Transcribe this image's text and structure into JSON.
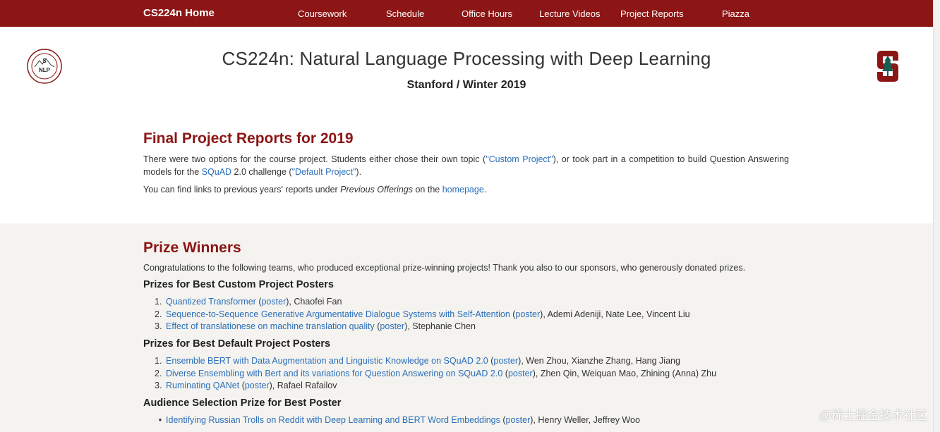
{
  "nav": {
    "brand": "CS224n Home",
    "links": [
      "Coursework",
      "Schedule",
      "Office Hours",
      "Lecture Videos",
      "Project Reports",
      "Piazza"
    ]
  },
  "header": {
    "title": "CS224n: Natural Language Processing with Deep Learning",
    "subtitle": "Stanford / Winter 2019",
    "seal_top_text": "S",
    "seal_bottom_text": "NLP"
  },
  "reports": {
    "title": "Final Project Reports for 2019",
    "p1_a": "There were two options for the course project. Students either chose their own topic (",
    "p1_link1": "\"Custom Project\"",
    "p1_b": "), or took part in a competition to build Question Answering models for the ",
    "p1_link2": "SQuAD",
    "p1_c": " 2.0 challenge (",
    "p1_link3": "\"Default Project\"",
    "p1_d": ").",
    "p2_a": "You can find links to previous years' reports under ",
    "p2_em": "Previous Offerings",
    "p2_b": " on the ",
    "p2_link": "homepage",
    "p2_c": "."
  },
  "prizes": {
    "title": "Prize Winners",
    "intro": "Congratulations to the following teams, who produced exceptional prize-winning projects! Thank you also to our sponsors, who generously donated prizes.",
    "custom": {
      "heading": "Prizes for Best Custom Project Posters",
      "items": [
        {
          "n": "1.",
          "title": "Quantized Transformer",
          "poster": "poster",
          "authors": "), Chaofei Fan"
        },
        {
          "n": "2.",
          "title": "Sequence-to-Sequence Generative Argumentative Dialogue Systems with Self-Attention",
          "poster": "poster",
          "authors": "), Ademi Adeniji, Nate Lee, Vincent Liu"
        },
        {
          "n": "3.",
          "title": "Effect of translationese on machine translation quality",
          "poster": "poster",
          "authors": "), Stephanie Chen"
        }
      ]
    },
    "default": {
      "heading": "Prizes for Best Default Project Posters",
      "items": [
        {
          "n": "1.",
          "title": "Ensemble BERT with Data Augmentation and Linguistic Knowledge on SQuAD 2.0",
          "poster": "poster",
          "authors": "), Wen Zhou, Xianzhe Zhang, Hang Jiang"
        },
        {
          "n": "2.",
          "title": "Diverse Ensembling with Bert and its variations for Question Answering on SQuAD 2.0",
          "poster": "poster",
          "authors": "), Zhen Qin, Weiquan Mao, Zhining (Anna) Zhu"
        },
        {
          "n": "3.",
          "title": "Ruminating QANet",
          "poster": "poster",
          "authors": "), Rafael Rafailov"
        }
      ]
    },
    "audience": {
      "heading": "Audience Selection Prize for Best Poster",
      "items": [
        {
          "n": "•",
          "title": "Identifying Russian Trolls on Reddit with Deep Learning and BERT Word Embeddings",
          "poster": "poster",
          "authors": "), Henry Weller, Jeffrey Woo"
        }
      ]
    }
  },
  "watermark": "@稀土掘金技术社区",
  "colors": {
    "brand": "#8c1515",
    "link": "#2a6ebb",
    "band": "#f4f3ef"
  }
}
